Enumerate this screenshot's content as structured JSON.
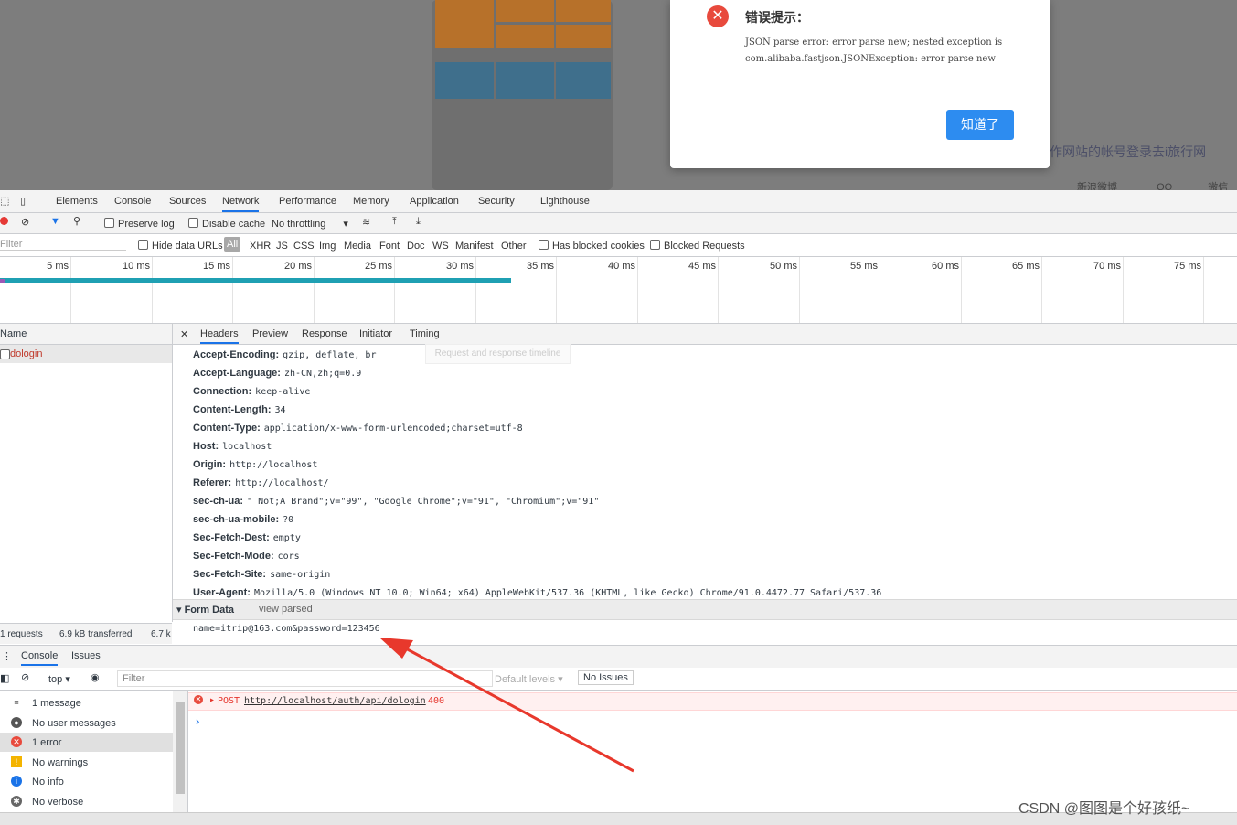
{
  "dialog": {
    "title": "错误提示：",
    "message": "JSON parse error: error parse new; nested exception is com.alibaba.fastjson.JSONException: error parse new",
    "ok_label": "知道了"
  },
  "background_page": {
    "login_text": "作网站的帐号登录去i旅行网",
    "social": [
      "新浪微博",
      "QQ",
      "微信"
    ]
  },
  "devtools": {
    "tabs": [
      "Elements",
      "Console",
      "Sources",
      "Network",
      "Performance",
      "Memory",
      "Application",
      "Security",
      "Lighthouse"
    ],
    "active_tab": "Network",
    "toolbar": {
      "preserve_log": "Preserve log",
      "disable_cache": "Disable cache",
      "throttling": "No throttling"
    },
    "filter": {
      "placeholder": "Filter",
      "hide_data_urls": "Hide data URLs",
      "all": "All",
      "types": [
        "XHR",
        "JS",
        "CSS",
        "Img",
        "Media",
        "Font",
        "Doc",
        "WS",
        "Manifest",
        "Other"
      ],
      "blocked_cookies": "Has blocked cookies",
      "blocked_requests": "Blocked Requests"
    },
    "timeline_ticks": [
      "5 ms",
      "10 ms",
      "15 ms",
      "20 ms",
      "25 ms",
      "30 ms",
      "35 ms",
      "40 ms",
      "45 ms",
      "50 ms",
      "55 ms",
      "60 ms",
      "65 ms",
      "70 ms",
      "75 ms"
    ],
    "name_column": "Name",
    "request_name": "dologin",
    "status": {
      "requests": "1 requests",
      "transferred": "6.9 kB transferred",
      "resources": "6.7 k"
    },
    "detail_tabs": [
      "Headers",
      "Preview",
      "Response",
      "Initiator",
      "Timing"
    ],
    "tooltip": "Request and response timeline",
    "headers": [
      {
        "k": "Accept-Encoding:",
        "v": "gzip, deflate, br"
      },
      {
        "k": "Accept-Language:",
        "v": "zh-CN,zh;q=0.9"
      },
      {
        "k": "Connection:",
        "v": "keep-alive"
      },
      {
        "k": "Content-Length:",
        "v": "34"
      },
      {
        "k": "Content-Type:",
        "v": "application/x-www-form-urlencoded;charset=utf-8"
      },
      {
        "k": "Host:",
        "v": "localhost"
      },
      {
        "k": "Origin:",
        "v": "http://localhost"
      },
      {
        "k": "Referer:",
        "v": "http://localhost/"
      },
      {
        "k": "sec-ch-ua:",
        "v": "\" Not;A Brand\";v=\"99\", \"Google Chrome\";v=\"91\", \"Chromium\";v=\"91\""
      },
      {
        "k": "sec-ch-ua-mobile:",
        "v": "?0"
      },
      {
        "k": "Sec-Fetch-Dest:",
        "v": "empty"
      },
      {
        "k": "Sec-Fetch-Mode:",
        "v": "cors"
      },
      {
        "k": "Sec-Fetch-Site:",
        "v": "same-origin"
      },
      {
        "k": "User-Agent:",
        "v": "Mozilla/5.0 (Windows NT 10.0; Win64; x64) AppleWebKit/537.36 (KHTML, like Gecko) Chrome/91.0.4472.77 Safari/537.36"
      }
    ],
    "form_data_title": "Form Data",
    "view_parsed": "view parsed",
    "form_data": "name=itrip@163.com&password=123456"
  },
  "console": {
    "tabs": [
      "Console",
      "Issues"
    ],
    "context": "top",
    "filter_placeholder": "Filter",
    "levels": "Default levels",
    "issues": "No Issues",
    "sidebar": [
      "1 message",
      "No user messages",
      "1 error",
      "No warnings",
      "No info",
      "No verbose"
    ],
    "error_method": "POST",
    "error_url": "http://localhost/auth/api/dologin",
    "error_code": "400",
    "prompt": "›"
  },
  "watermark": "CSDN @图图是个好孩纸~",
  "colors": {
    "accent": "#1a73e8",
    "error": "#e84a3d",
    "button": "#2d8cf0"
  }
}
